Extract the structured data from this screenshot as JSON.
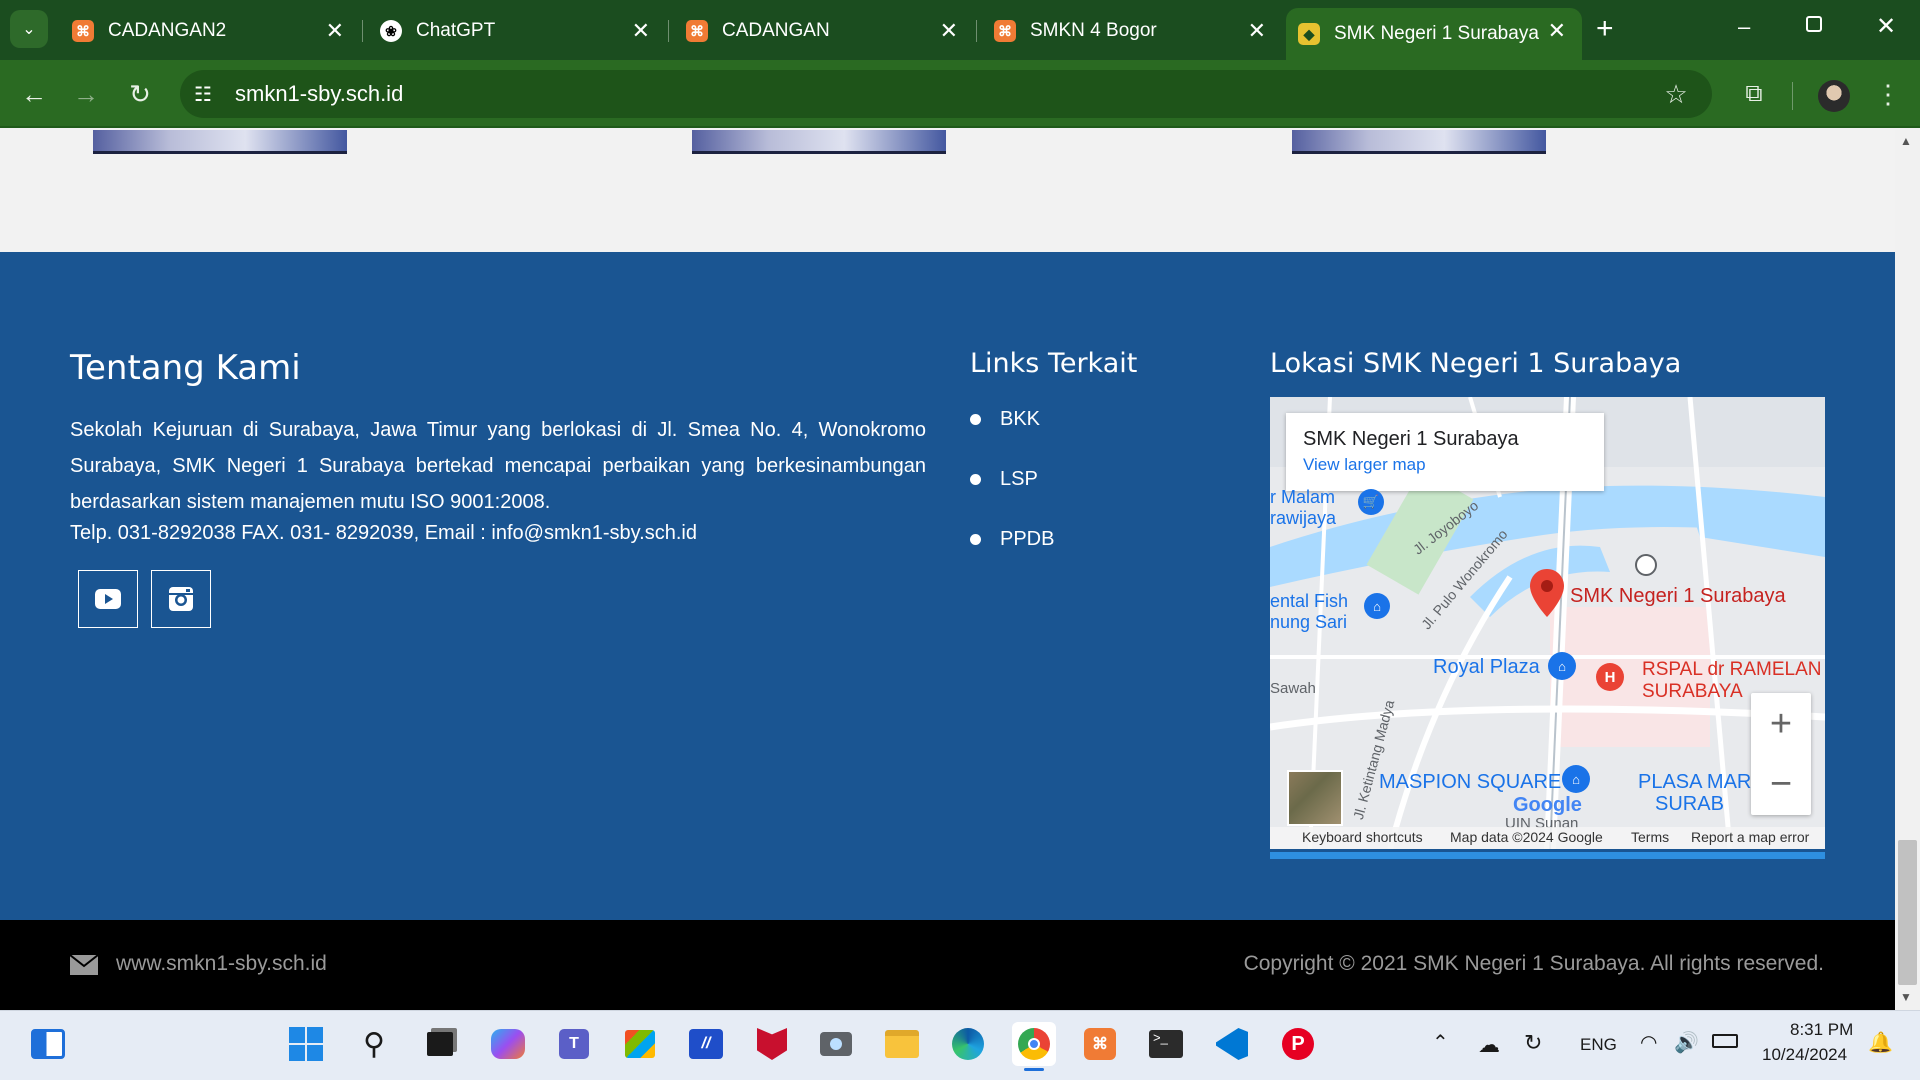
{
  "browser": {
    "tabs": [
      {
        "title": "CADANGAN2",
        "icon": "xampp-icon",
        "active": false
      },
      {
        "title": "ChatGPT",
        "icon": "chatgpt-icon",
        "active": false
      },
      {
        "title": "CADANGAN",
        "icon": "xampp-icon",
        "active": false
      },
      {
        "title": "SMKN 4 Bogor",
        "icon": "xampp-icon",
        "active": false
      },
      {
        "title": "SMK Negeri 1 Surabaya",
        "icon": "school-emblem-icon",
        "active": true
      }
    ],
    "new_tab": "+",
    "url": "smkn1-sby.sch.id"
  },
  "footer": {
    "about": {
      "heading": "Tentang Kami",
      "text": "Sekolah Kejuruan di Surabaya, Jawa Timur yang berlokasi di Jl. Smea No. 4, Wonokromo Surabaya, SMK Negeri 1 Surabaya bertekad mencapai perbaikan yang berkesinambungan berdasarkan sistem manajemen mutu ISO 9001:2008.",
      "contact": "Telp. 031-8292038 FAX. 031- 8292039, Email : info@smkn1-sby.sch.id"
    },
    "links": {
      "heading": "Links Terkait",
      "items": [
        "BKK",
        "LSP",
        "PPDB"
      ]
    },
    "location": {
      "heading": "Lokasi SMK Negeri 1 Surabaya",
      "map": {
        "place_name": "SMK Negeri 1 Surabaya",
        "view_larger": "View larger map",
        "marker_label": "SMK Negeri 1 Surabaya",
        "labels": {
          "royal_plaza": "Royal Plaza",
          "rspal": "RSPAL dr RAMELAN",
          "rspal2": "SURABAYA",
          "maspion": "MASPION SQUARE",
          "plasa": "PLASA MAR",
          "plasa2": "SURAB",
          "road1": "Jl. Joyoboyo",
          "road2": "Jl. Pulo Wonokromo",
          "road3": "Jl. Ketintang Madya",
          "malam": "r Malam",
          "rawijaya": "rawijaya",
          "ental": "ental Fish",
          "ungsari": "nung Sari",
          "sawah": "Sawah",
          "uin": "UIN Sunan",
          "google": "Google"
        },
        "attribution": {
          "shortcuts": "Keyboard shortcuts",
          "data": "Map data ©2024 Google",
          "terms": "Terms",
          "report": "Report a map error"
        },
        "zoom_in": "+",
        "zoom_out": "−"
      }
    },
    "bottom": {
      "website": "www.smkn1-sby.sch.id",
      "copyright": "Copyright © 2021 SMK Negeri 1 Surabaya. All rights reserved."
    }
  },
  "taskbar": {
    "lang": "ENG",
    "time": "8:31 PM",
    "date": "10/24/2024"
  },
  "colors": {
    "tabbar": "#1b4d1f",
    "toolbar": "#2a6a22",
    "footer": "#1a5592",
    "footer_bottom": "#000000"
  }
}
